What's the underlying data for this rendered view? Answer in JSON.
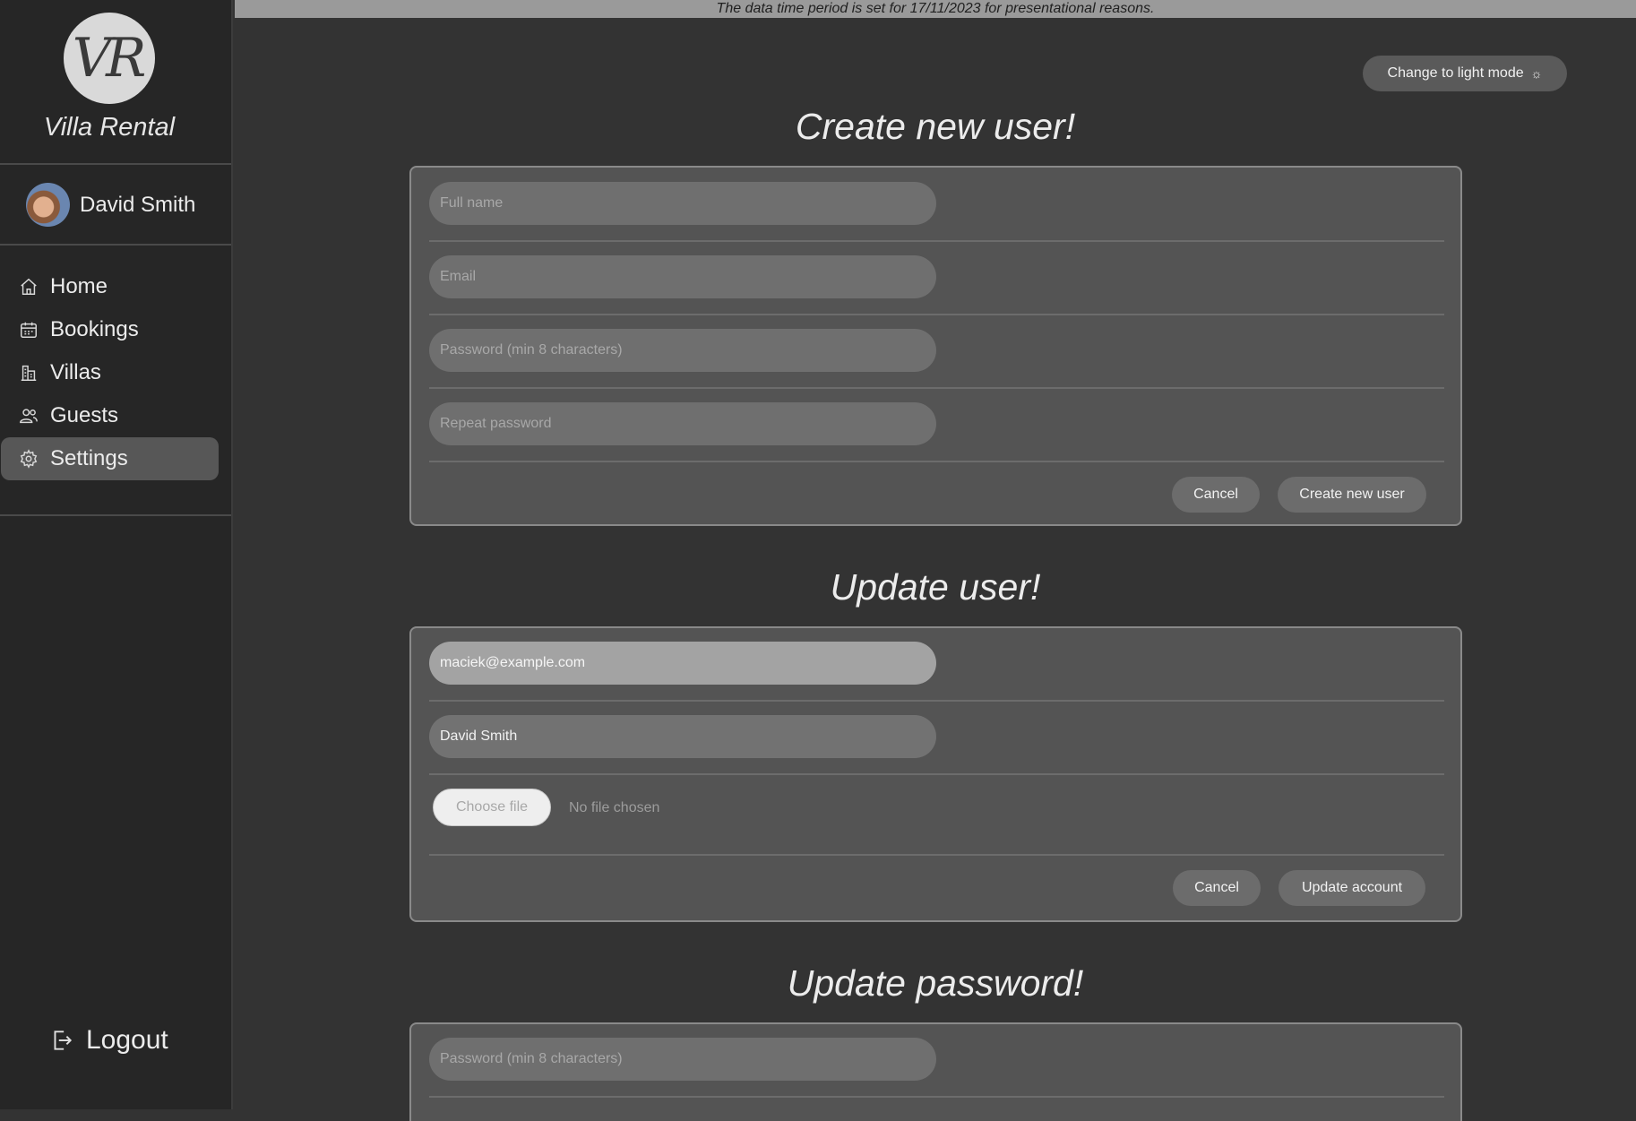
{
  "banner": {
    "text": "The data time period is set for 17/11/2023 for presentational reasons."
  },
  "sidebar": {
    "logo_text": "VR",
    "brand": "Villa Rental",
    "user_name": "David Smith",
    "items": [
      {
        "label": "Home",
        "icon": "home-icon"
      },
      {
        "label": "Bookings",
        "icon": "calendar-icon"
      },
      {
        "label": "Villas",
        "icon": "building-icon"
      },
      {
        "label": "Guests",
        "icon": "users-icon"
      },
      {
        "label": "Settings",
        "icon": "gear-icon",
        "active": true
      }
    ],
    "logout_label": "Logout"
  },
  "header": {
    "theme_button_label": "Change to light mode",
    "theme_icon": "sun-icon"
  },
  "create_user": {
    "title": "Create new user!",
    "full_name_placeholder": "Full name",
    "email_placeholder": "Email",
    "password_placeholder": "Password (min 8 characters)",
    "repeat_password_placeholder": "Repeat password",
    "cancel_label": "Cancel",
    "submit_label": "Create new user"
  },
  "update_user": {
    "title": "Update user!",
    "email_value": "maciek@example.com",
    "name_value": "David Smith",
    "choose_file_label": "Choose file",
    "file_status": "No file chosen",
    "cancel_label": "Cancel",
    "submit_label": "Update account"
  },
  "update_password": {
    "title": "Update password!",
    "password_placeholder": "Password (min 8 characters)"
  },
  "colors": {
    "background": "#333333",
    "sidebar": "#262626",
    "card": "#545454",
    "active_nav": "#575757",
    "banner": "#9a9a9a"
  }
}
